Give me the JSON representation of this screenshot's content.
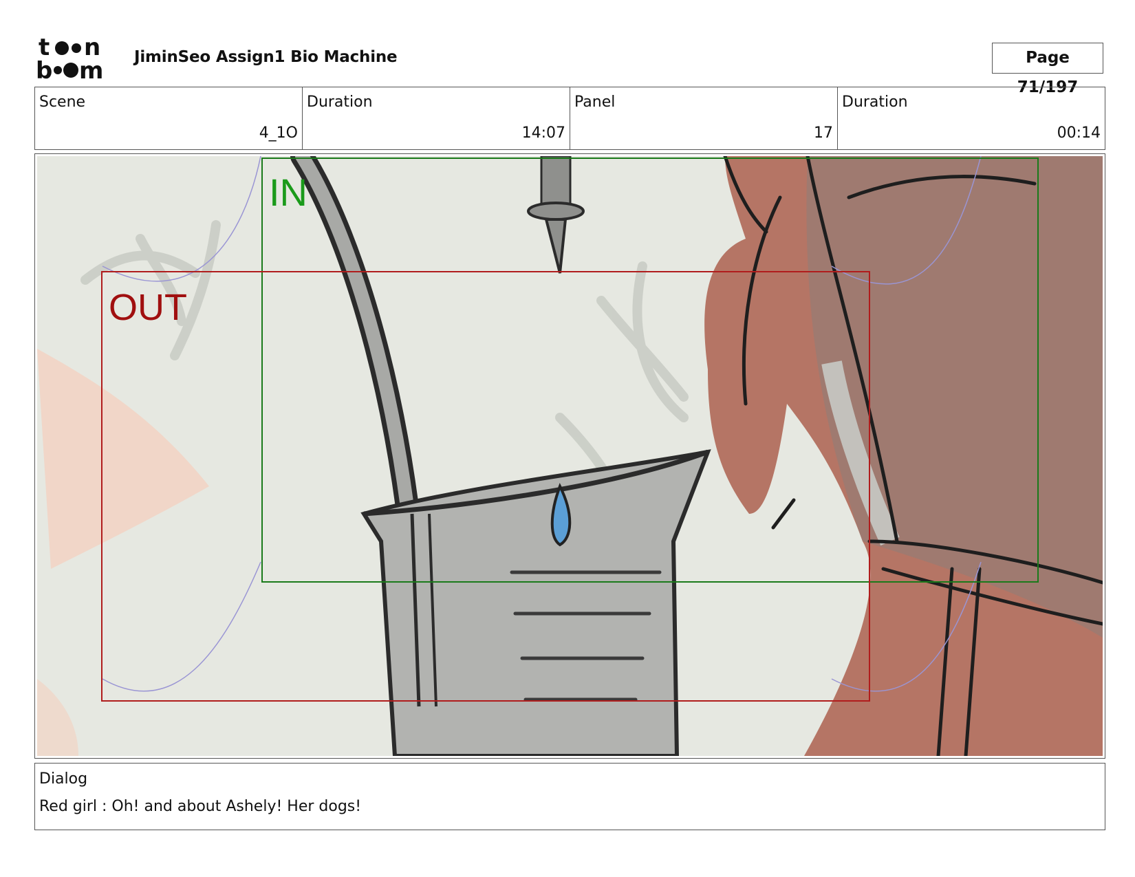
{
  "logo": {
    "top_text": "toon",
    "bottom_text": "boom"
  },
  "header": {
    "title": "JiminSeo Assign1 Bio Machine",
    "page_label": "Page  71/197"
  },
  "info": {
    "scene_label": "Scene",
    "scene_value": "4_1O",
    "duration1_label": "Duration",
    "duration1_value": "14:07",
    "panel_label": "Panel",
    "panel_value": "17",
    "duration2_label": "Duration",
    "duration2_value": "00:14"
  },
  "frame": {
    "in_label": "IN",
    "out_label": "OUT",
    "in_color": "#1a7a1a",
    "out_color": "#b01c1c"
  },
  "dialog": {
    "label": "Dialog",
    "text": "Red girl : Oh! and about Ashely! Her dogs!"
  }
}
